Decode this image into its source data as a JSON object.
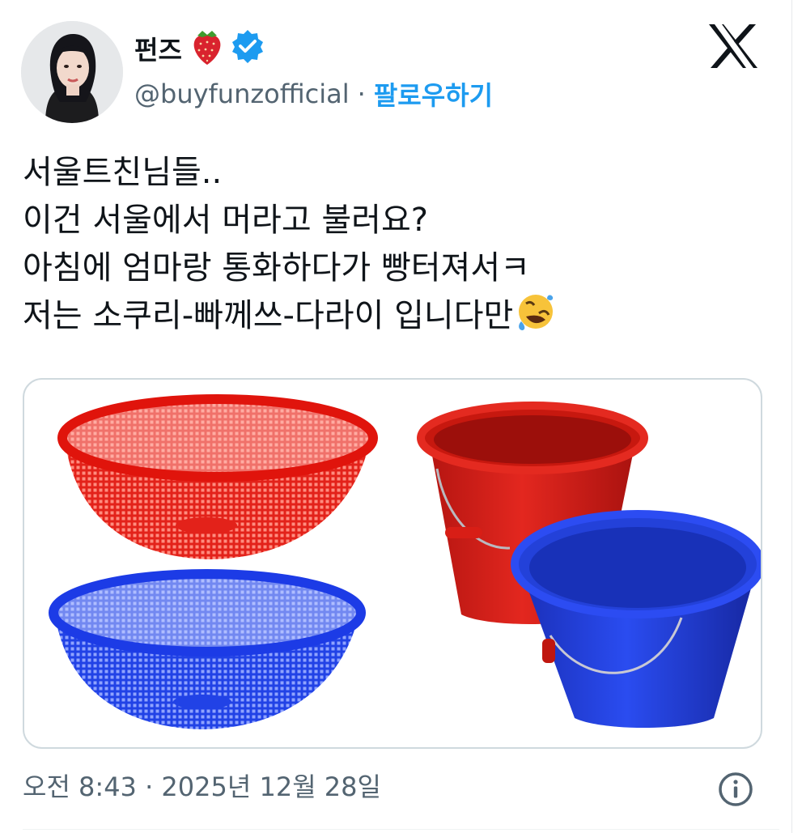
{
  "header": {
    "display_name": "펀즈",
    "handle": "@buyfunzofficial",
    "separator": "·",
    "follow_label": "팔로우하기",
    "name_emoji_icon": "strawberry-icon",
    "verified_icon": "verified-badge-icon",
    "platform_logo_icon": "x-logo-icon"
  },
  "tweet": {
    "lines": [
      "서울트친님들..",
      "이건 서울에서 머라고 불러요?",
      "아침에 엄마랑 통화하다가 빵터져서ㅋ",
      "저는 소쿠리-빠께쓰-다라이 입니다만"
    ],
    "trailing_emoji_icon": "rolling-laughing-emoji-icon"
  },
  "media": {
    "items": [
      "red-colander",
      "blue-colander",
      "red-bucket",
      "blue-bucket"
    ]
  },
  "footer": {
    "timestamp": "오전 8:43 · 2025년 12월 28일",
    "info_icon": "info-icon"
  },
  "colors": {
    "text": "#0f1419",
    "secondary": "#536471",
    "accent": "#1d9bf0",
    "red_plastic": "#e11b12",
    "blue_plastic": "#1f3fe0"
  }
}
